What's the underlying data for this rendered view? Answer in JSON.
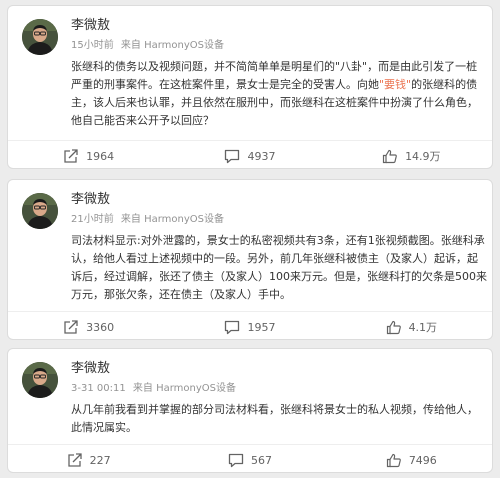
{
  "posts": [
    {
      "author": "李微敖",
      "time": "15小时前",
      "source": "来自 HarmonyOS设备",
      "text_parts": [
        "张继科的债务以及视频问题，并不简简单单是明星们的\"八卦\"，而是由此引发了一桩严重的刑事案件。在这桩案件里，景女士是完全的受害人。向她",
        "\"要钱\"",
        "的张继科的债主，该人后来也认罪，并且依然在服刑中，而张继科在这桩案件中扮演了什么角色，他自己能否来公开予以回应？"
      ],
      "shares": "1964",
      "comments": "4937",
      "likes": "14.9万"
    },
    {
      "author": "李微敖",
      "time": "21小时前",
      "source": "来自 HarmonyOS设备",
      "text_parts": [
        "司法材料显示:对外泄露的，景女士的私密视频共有3条，还有1张视频截图。张继科承认，给他人看过上述视频中的一段。另外，前几年张继科被债主（及家人）起诉，起诉后，经过调解，张还了债主（及家人）100来万元。但是，张继科打的欠条是500来万元，那张欠条，还在债主（及家人）手中。"
      ],
      "shares": "3360",
      "comments": "1957",
      "likes": "4.1万"
    },
    {
      "author": "李微敖",
      "time": "3-31 00:11",
      "source": "来自 HarmonyOS设备",
      "text_parts": [
        "从几年前我看到并掌握的部分司法材料看，张继科将景女士的私人视频，传给他人，此情况属实。"
      ],
      "shares": "227",
      "comments": "567",
      "likes": "7496"
    }
  ],
  "colors": {
    "highlight": "#eb7350",
    "text": "#333333",
    "meta": "#939393",
    "icons": "#636363"
  },
  "icons": [
    "avatar",
    "share-icon",
    "comment-icon",
    "like-icon"
  ]
}
